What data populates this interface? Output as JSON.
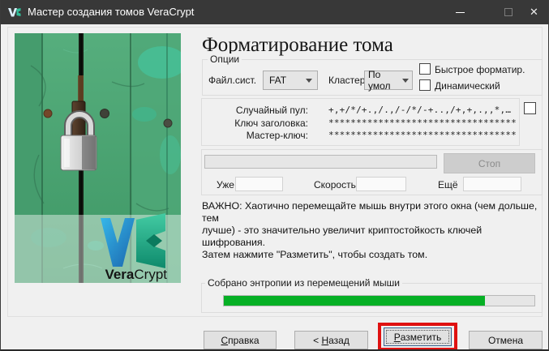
{
  "window": {
    "title": "Мастер создания томов VeraCrypt"
  },
  "page": {
    "heading": "Форматирование тома"
  },
  "options": {
    "group_label": "Опции",
    "filesystem_label": "Файл.сист.",
    "filesystem_value": "FAT",
    "cluster_label": "Кластер",
    "cluster_value": "По умол",
    "quick_format_label": "Быстрое форматир.",
    "dynamic_label": "Динамический"
  },
  "random_pool": {
    "rows": [
      {
        "label": "Случайный пул:",
        "value": "+,+/*/+.,/.,/-/*/-+..,/+,+,.,,*,…"
      },
      {
        "label": "Ключ заголовка:",
        "value": "************************************"
      },
      {
        "label": "Мастер-ключ:",
        "value": "************************************"
      }
    ]
  },
  "format_progress": {
    "percent": 0,
    "stop_label": "Стоп",
    "done_label": "Уже",
    "speed_label": "Скорость",
    "left_label": "Ещё",
    "done_value": "",
    "speed_value": "",
    "left_value": ""
  },
  "notice": {
    "lines": [
      "ВАЖНО: Хаотично перемещайте мышь внутри этого окна (чем дольше, тем",
      "лучше) - это значительно увеличит криптостойкость ключей шифрования.",
      "Затем нажмите \"Разметить\", чтобы создать том."
    ]
  },
  "entropy": {
    "group_label": "Собрано энтропии из перемещений мыши",
    "percent": 84
  },
  "footer_buttons": {
    "help": {
      "accel": "С",
      "rest": "правка"
    },
    "back": {
      "prefix": "< ",
      "accel": "Н",
      "rest": "азад"
    },
    "format": {
      "accel": "Р",
      "rest": "азметить"
    },
    "cancel": {
      "label": "Отмена"
    }
  },
  "branding": {
    "vera": "Vera",
    "crypt": "Crypt"
  },
  "colors": {
    "titlebar": "#383838",
    "entropy_fill": "#06b025",
    "highlight_box": "#df1111",
    "disabled_text": "#8a8a8a"
  }
}
